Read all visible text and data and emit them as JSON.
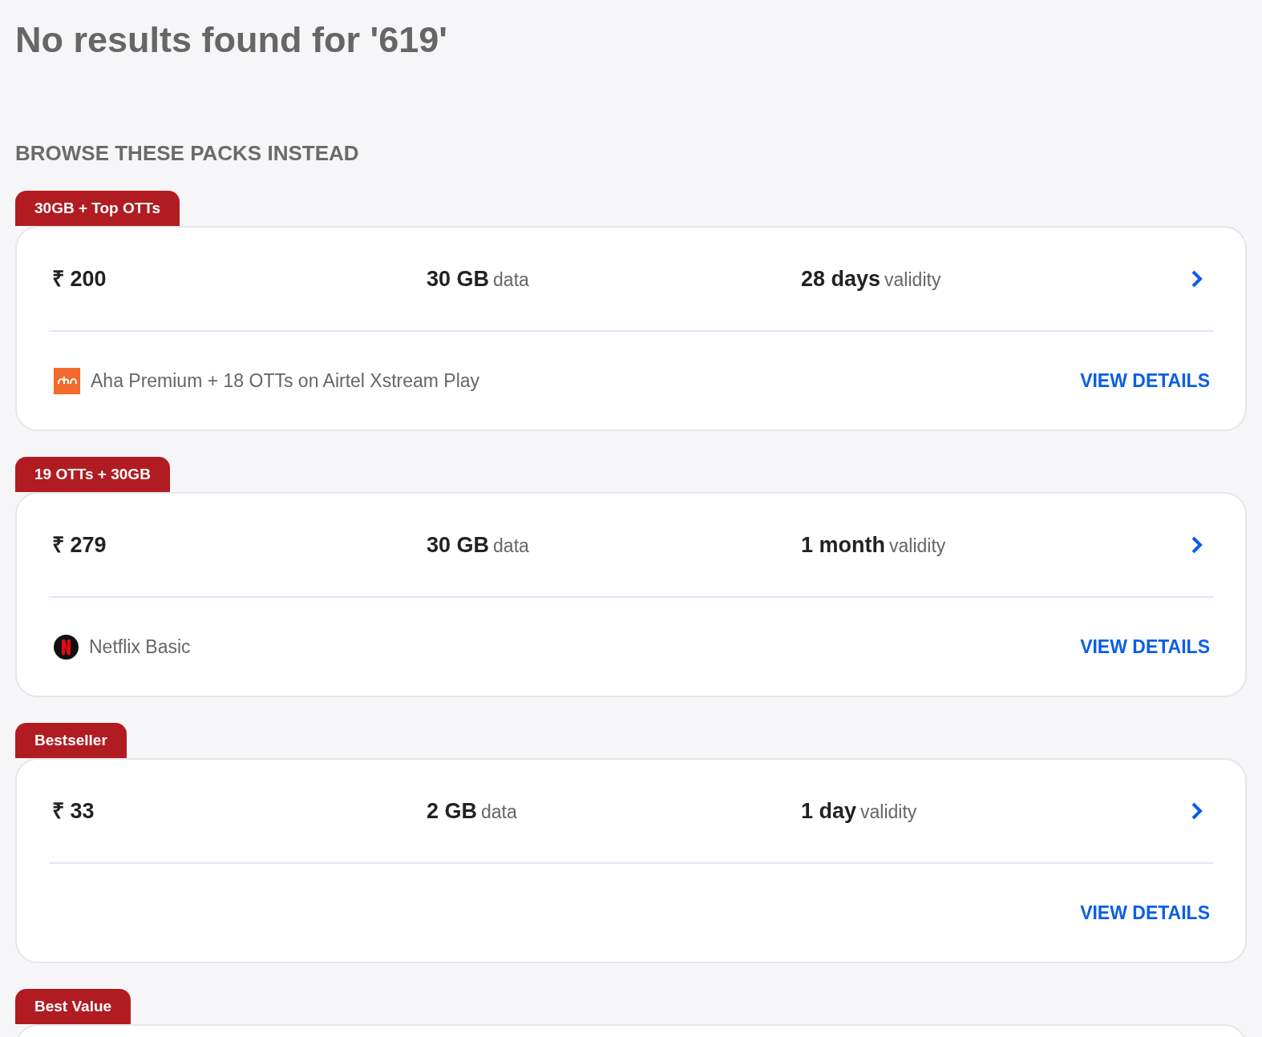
{
  "title": "No results found for '619'",
  "section_heading": "BROWSE THESE PACKS INSTEAD",
  "packs": [
    {
      "tag": "30GB + Top OTTs",
      "price": "₹ 200",
      "data_amount": "30 GB",
      "data_label": "data",
      "validity_amount": "28 days",
      "validity_label": "validity",
      "benefits": [
        {
          "kind": "aha",
          "text": "Aha Premium + 18 OTTs on Airtel Xstream Play"
        }
      ],
      "action": "VIEW DETAILS"
    },
    {
      "tag": "19 OTTs + 30GB",
      "price": "₹ 279",
      "data_amount": "30 GB",
      "data_label": "data",
      "validity_amount": "1 month",
      "validity_label": "validity",
      "benefits": [
        {
          "kind": "netflix",
          "text": "Netflix Basic"
        }
      ],
      "action": "VIEW DETAILS"
    },
    {
      "tag": "Bestseller",
      "price": "₹ 33",
      "data_amount": "2 GB",
      "data_label": "data",
      "validity_amount": "1 day",
      "validity_label": "validity",
      "action": "VIEW DETAILS"
    },
    {
      "tag": "Best Value"
    }
  ]
}
